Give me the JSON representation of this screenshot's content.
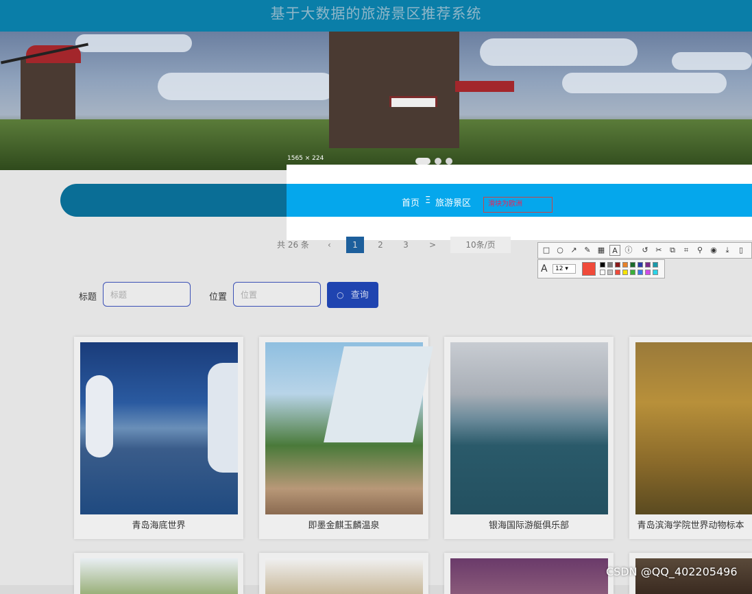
{
  "header": {
    "title": "基于大数据的旅游景区推荐系统"
  },
  "screenshot_tool": {
    "size_label": "1565 × 224",
    "nav": {
      "home": "首页",
      "separator": "Ξ",
      "scenic": "旅游景区"
    },
    "typed_text": "滑块为欧洲",
    "font_size": "12",
    "active_color": "#f04a3a",
    "tools": [
      "rectangle-icon",
      "ellipse-icon",
      "arrow-icon",
      "pen-icon",
      "mosaic-icon",
      "text-icon",
      "number-icon",
      "undo-icon",
      "cut-icon",
      "copy-icon",
      "ocr-icon",
      "pin-icon",
      "record-icon",
      "save-icon",
      "phone-icon"
    ],
    "palette": [
      "#000000",
      "#7f7f7f",
      "#8b1a1a",
      "#e8822a",
      "#1a6a2a",
      "#2a3aa8",
      "#7a2a8a",
      "#1a9aaa",
      "#ffffff",
      "#c0c0c0",
      "#f04a3a",
      "#f6e400",
      "#3ab03a",
      "#3a7ae8",
      "#d04ae8",
      "#2ad4e8"
    ]
  },
  "pagination": {
    "total": "共 26 条",
    "prev": "‹",
    "pages": [
      "1",
      "2",
      "3"
    ],
    "next": ">",
    "page_size": "10条/页"
  },
  "search": {
    "title_label": "标题",
    "title_placeholder": "标题",
    "location_label": "位置",
    "location_placeholder": "位置",
    "query_button": "查询"
  },
  "cards": [
    {
      "name": "青岛海底世界"
    },
    {
      "name": "即墨金麒玉麟温泉"
    },
    {
      "name": "银海国际游艇俱乐部"
    },
    {
      "name": "青岛滨海学院世界动物标本"
    }
  ],
  "watermark": "CSDN @QQ_402205496"
}
